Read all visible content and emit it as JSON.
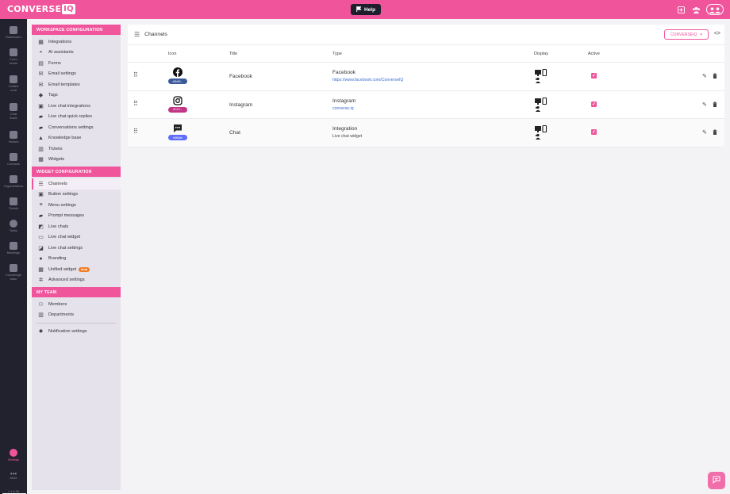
{
  "app": {
    "logo_text": "CONVERSE",
    "logo_suffix": "IQ",
    "help_label": "Help",
    "brand_color": "#f0559c"
  },
  "rail": {
    "items": [
      {
        "label": "Dashboard",
        "icon": "dashboard-icon"
      },
      {
        "label": "Form leads",
        "icon": "form-leads-icon"
      },
      {
        "label": "Unified chat",
        "icon": "chat-icon"
      },
      {
        "label": "Chat flows",
        "icon": "flow-icon"
      },
      {
        "label": "Visitors",
        "icon": "visitors-icon"
      },
      {
        "label": "Contacts",
        "icon": "contacts-icon"
      },
      {
        "label": "Organizations",
        "icon": "organizations-icon"
      },
      {
        "label": "Tickets",
        "icon": "tickets-icon"
      },
      {
        "label": "Tasks",
        "icon": "tasks-icon"
      },
      {
        "label": "Meetings",
        "icon": "meetings-icon"
      },
      {
        "label": "Knowledge base",
        "icon": "knowledge-icon"
      }
    ],
    "settings_label": "Settings",
    "more_label": "More",
    "version": "v 1.6.95"
  },
  "menu": {
    "workspace_title": "WORKSPACE CONFIGURATION",
    "workspace_items": [
      {
        "label": "Integrations",
        "icon": "integrations-icon"
      },
      {
        "label": "AI assistants",
        "icon": "ai-assistant-icon"
      },
      {
        "label": "Forms",
        "icon": "forms-icon"
      },
      {
        "label": "Email settings",
        "icon": "email-icon"
      },
      {
        "label": "Email templates",
        "icon": "email-template-icon"
      },
      {
        "label": "Tags",
        "icon": "tag-icon"
      },
      {
        "label": "Live chat integrations",
        "icon": "live-chat-integration-icon"
      },
      {
        "label": "Live chat quick replies",
        "icon": "quick-replies-icon"
      },
      {
        "label": "Conversations settings",
        "icon": "conversations-icon"
      },
      {
        "label": "Knowledge base",
        "icon": "knowledge-base-icon"
      },
      {
        "label": "Tickets",
        "icon": "tickets-icon"
      },
      {
        "label": "Widgets",
        "icon": "widgets-icon"
      }
    ],
    "widget_title": "WIDGET CONFIGURATION",
    "widget_items": [
      {
        "label": "Channels",
        "icon": "list-icon"
      },
      {
        "label": "Button settings",
        "icon": "button-icon"
      },
      {
        "label": "Menu settings",
        "icon": "menu-icon"
      },
      {
        "label": "Prompt messages",
        "icon": "prompt-icon"
      },
      {
        "label": "Live chats",
        "icon": "live-chats-icon"
      },
      {
        "label": "Live chat widget",
        "icon": "chat-widget-icon"
      },
      {
        "label": "Live chat settings",
        "icon": "chat-settings-icon"
      },
      {
        "label": "Branding",
        "icon": "branding-icon"
      },
      {
        "label": "Unified widget",
        "icon": "unified-widget-icon"
      },
      {
        "label": "Advanced settings",
        "icon": "gear-icon"
      }
    ],
    "unified_badge": "beta",
    "team_title": "MY TEAM",
    "team_items": [
      {
        "label": "Members",
        "icon": "members-icon"
      },
      {
        "label": "Departments",
        "icon": "departments-icon"
      }
    ],
    "notification_label": "Notification settings"
  },
  "main": {
    "title": "Channels",
    "dropdown_value": "CONVERSEIQ",
    "columns": {
      "icon": "Icon",
      "title": "Title",
      "type": "Type",
      "display": "Display",
      "active": "Active"
    },
    "rows": [
      {
        "icon": "facebook-icon",
        "chip": "#3b59...",
        "chip_color": "#3b5998",
        "title": "Facebook",
        "type": "Facebook",
        "type_sub": "https://www.facebook.com/ConverseIQ",
        "active": true
      },
      {
        "icon": "instagram-icon",
        "chip": "#C13...",
        "chip_color": "#c13584",
        "title": "Instagram",
        "type": "Instagram",
        "type_sub": "converse.iq",
        "active": true
      },
      {
        "icon": "chat-bubble-icon",
        "chip": "#5f6dfe",
        "chip_color": "#5f6dfe",
        "title": "Chat",
        "type": "Integration",
        "type_sub": "Live chat widget",
        "active": true
      }
    ]
  }
}
